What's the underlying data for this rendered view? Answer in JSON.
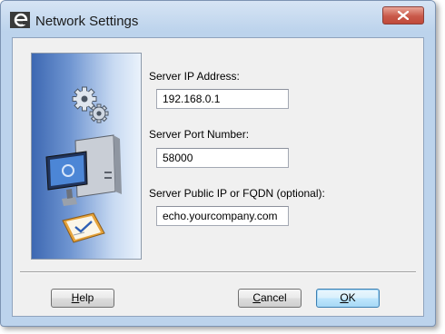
{
  "window": {
    "title": "Network Settings",
    "accent": "#bcd3ec",
    "close_color": "#c9594a"
  },
  "icons": {
    "app": "echo-e-icon",
    "close": "close-icon",
    "gears": "gears-icon",
    "computer": "computer-icon",
    "clipboard": "clipboard-check-icon"
  },
  "form": {
    "server_ip_label": "Server IP Address:",
    "server_ip_value": "192.168.0.1",
    "server_port_label": "Server Port Number:",
    "server_port_value": "58000",
    "server_public_label": "Server Public IP or FQDN (optional):",
    "server_public_value": "echo.yourcompany.com"
  },
  "buttons": {
    "help_first": "H",
    "help_rest": "elp",
    "cancel_first": "C",
    "cancel_rest": "ancel",
    "ok_first": "O",
    "ok_rest": "K"
  }
}
